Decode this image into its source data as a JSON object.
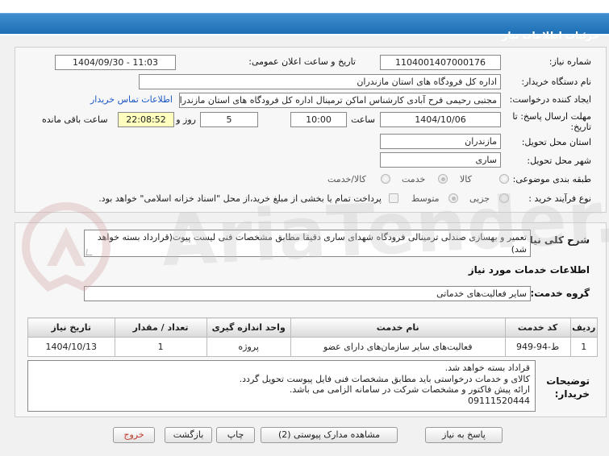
{
  "header": {
    "title": "جزئیات اطلاعات نیاز"
  },
  "form": {
    "need_number_label": "شماره نیاز:",
    "need_number": "1104001407000176",
    "announce_label": "تاریخ و ساعت اعلان عمومی:",
    "announce_value": "1404/09/30 - 11:03",
    "buyer_org_label": "نام دستگاه خریدار:",
    "buyer_org": "اداره کل فرودگاه های استان مازندران",
    "creator_label": "ایجاد کننده درخواست:",
    "creator": "مجتبی رحیمی فرح آبادی کارشناس اماکن ترمینال اداره کل فرودگاه های استان مازندران",
    "contact_link": "اطلاعات تماس خریدار",
    "deadline_label": "مهلت ارسال پاسخ: تا تاریخ:",
    "deadline_date": "1404/10/06",
    "time_label": "ساعت",
    "deadline_time": "10:00",
    "days_value": "5",
    "days_label": "روز و",
    "remaining_time": "22:08:52",
    "remaining_label": "ساعت باقی مانده",
    "province_label": "استان محل تحویل:",
    "province": "مازندران",
    "city_label": "شهر محل تحویل:",
    "city": "ساری",
    "category_label": "طبقه بندی موضوعی:",
    "category_options": [
      "کالا",
      "خدمت",
      "کالا/خدمت"
    ],
    "category_selected": "خدمت",
    "process_label": "نوع فرآیند خرید :",
    "process_options": [
      "جزیی",
      "متوسط"
    ],
    "process_selected": "متوسط",
    "payment_note": "پرداخت تمام یا بخشی از مبلغ خرید،از محل \"اسناد خزانه اسلامی\" خواهد بود."
  },
  "general": {
    "desc_label": "شرح کلی نیاز:",
    "desc_text": "تعمیر و بهسازی صندلی ترمینالی فرودگاه شهدای ساری دقیقا مطابق مشخصات فنی لیست پیوت(قرارداد بسته خواهد شد)",
    "services_heading": "اطلاعات خدمات مورد نیاز",
    "service_group_label": "گروه خدمت:",
    "service_group": "سایر فعالیت‌های خدماتی"
  },
  "table": {
    "headers": [
      "ردیف",
      "کد خدمت",
      "نام خدمت",
      "واحد اندازه گیری",
      "تعداد / مقدار",
      "تاریخ نیاز"
    ],
    "rows": [
      [
        "1",
        "ط-94-949",
        "فعالیت‌های سایر سازمان‌های دارای عضو",
        "پروژه",
        "1",
        "1404/10/13"
      ]
    ]
  },
  "buyer_notes": {
    "label": "توضیحات خریدار:",
    "lines": [
      "قراداد بسته خواهد شد.",
      "کالای  و خدمات درخواستی باید مطابق مشخصات فنی فایل پیوست تحویل گردد.",
      "ارائه پیش فاکتور و مشخصات شرکت در سامانه الزامی می باشد.",
      "09111520444"
    ]
  },
  "buttons": {
    "reply": "پاسخ به نیاز",
    "attachments": "مشاهده مدارک پیوستی (2)",
    "print": "چاپ",
    "back": "بازگشت",
    "exit": "خروج"
  },
  "watermark": {
    "text": "AriaTender.net"
  },
  "colors": {
    "header": "#2a7cc2",
    "link": "#1a56c4",
    "remaining_bg": "#fefebe",
    "exit_text": "#c0392b"
  }
}
